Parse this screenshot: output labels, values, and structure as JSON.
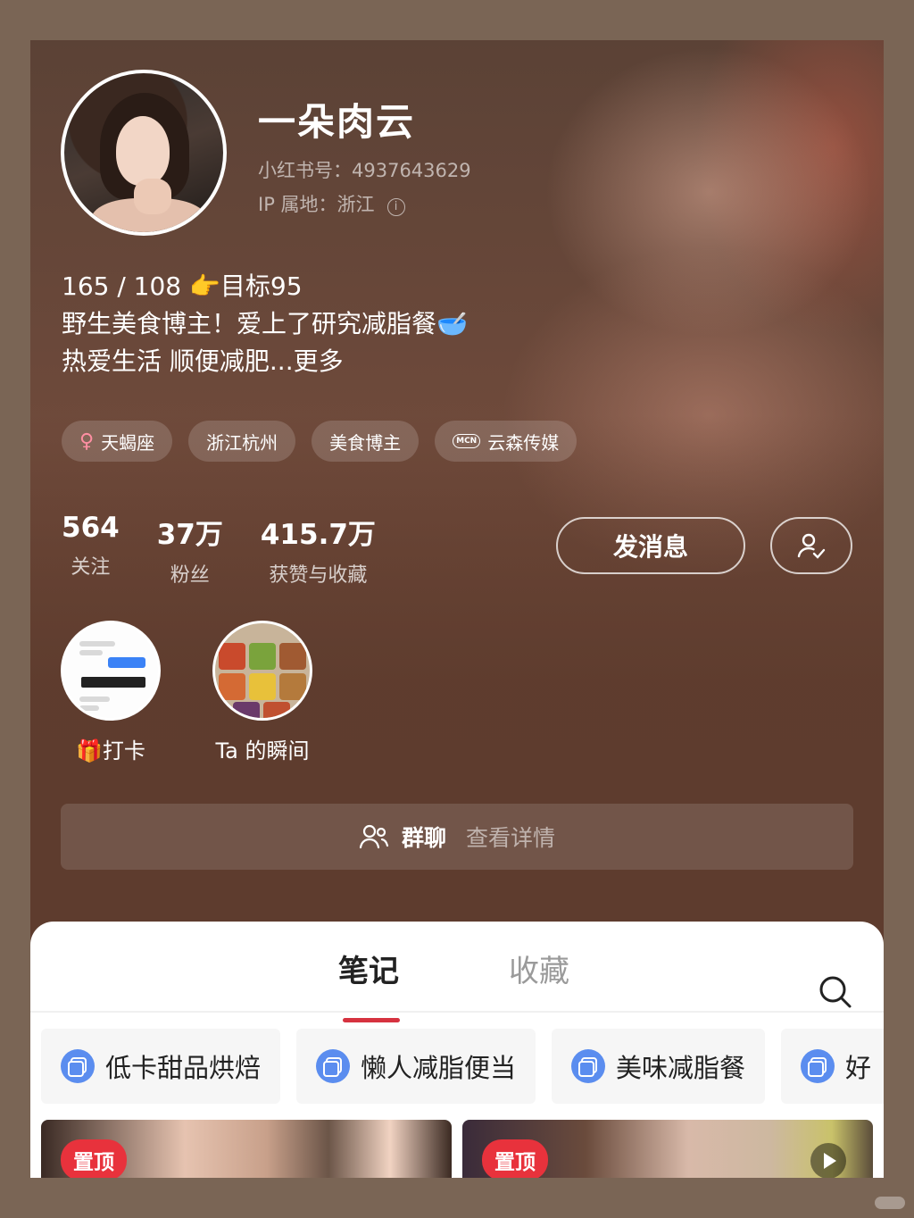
{
  "profile": {
    "name": "一朵肉云",
    "xhs_id": "小红书号：4937643629",
    "ip_location": "IP 属地：浙江",
    "bio_line1": "165 / 108 👉目标95",
    "bio_line2": "野生美食博主！爱上了研究减脂餐🥣",
    "bio_line3": "热爱生活 顺便减肥...更多"
  },
  "tags": [
    {
      "label": "天蝎座",
      "icon": "female-icon"
    },
    {
      "label": "浙江杭州",
      "icon": ""
    },
    {
      "label": "美食博主",
      "icon": ""
    },
    {
      "label": "云森传媒",
      "icon": "mcn-icon"
    }
  ],
  "stats": {
    "following": {
      "num": "564",
      "label": "关注"
    },
    "fans": {
      "num": "37万",
      "label": "粉丝"
    },
    "likes": {
      "num": "415.7万",
      "label": "获赞与收藏"
    }
  },
  "actions": {
    "message": "发消息"
  },
  "highlights": [
    {
      "label": "🎁打卡"
    },
    {
      "label": "Ta 的瞬间"
    }
  ],
  "group_chat": {
    "title": "群聊",
    "link": "查看详情"
  },
  "tabs": {
    "notes": "笔记",
    "collections": "收藏"
  },
  "collections": [
    "低卡甜品烘焙",
    "懒人减脂便当",
    "美味减脂餐",
    "好"
  ],
  "cards": [
    {
      "badge": "置顶"
    },
    {
      "badge": "置顶"
    }
  ],
  "colors": {
    "accent": "#d6323f",
    "pin": "#e8323c",
    "collection_icon": "#5b8def"
  }
}
